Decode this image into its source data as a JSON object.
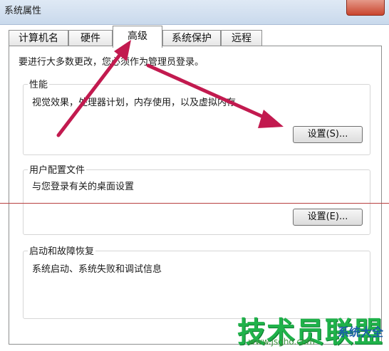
{
  "window": {
    "title": "系统属性"
  },
  "tabs": [
    {
      "label": "计算机名",
      "active": false
    },
    {
      "label": "硬件",
      "active": false
    },
    {
      "label": "高级",
      "active": true
    },
    {
      "label": "系统保护",
      "active": false
    },
    {
      "label": "远程",
      "active": false
    }
  ],
  "page": {
    "admin_note": "要进行大多数更改，您必须作为管理员登录。",
    "performance": {
      "title": "性能",
      "description": "视觉效果，处理器计划，内存使用，以及虚拟内存",
      "button_label": "设置(S)..."
    },
    "user_profiles": {
      "title": "用户配置文件",
      "description": "与您登录有关的桌面设置",
      "button_label": "设置(E)..."
    },
    "startup_recovery": {
      "title": "启动和故障恢复",
      "description": "系统启动、系统失败和调试信息"
    }
  },
  "annotation": {
    "arrow_color": "#c21a4f"
  },
  "watermark": {
    "logo": "技术员联盟",
    "url": "www.jsgho.com",
    "side": "系统大全"
  }
}
